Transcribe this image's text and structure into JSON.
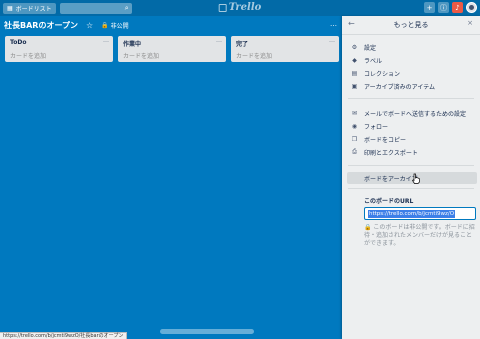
{
  "header": {
    "boards_label": "ボードリスト",
    "logo_text": "Trello",
    "search_icon": "search-icon",
    "right_icons": [
      "plus-icon",
      "info-icon",
      "bell-icon",
      "avatar"
    ]
  },
  "board": {
    "title": "社長BARのオープン",
    "visibility": "非公開",
    "more": "…"
  },
  "lists": [
    {
      "title": "ToDo",
      "add_card": "カードを追加",
      "menu": "…"
    },
    {
      "title": "作業中",
      "add_card": "カードを追加",
      "menu": "…"
    },
    {
      "title": "完了",
      "add_card": "カードを追加",
      "menu": "…"
    }
  ],
  "menu": {
    "title": "もっと見る",
    "back": "←",
    "close": "×",
    "group1": [
      {
        "icon": "gear-icon",
        "glyph": "⚙",
        "label": "設定"
      },
      {
        "icon": "label-icon",
        "glyph": "◆",
        "label": "ラベル"
      },
      {
        "icon": "collection-icon",
        "glyph": "▤",
        "label": "コレクション"
      },
      {
        "icon": "archive-icon",
        "glyph": "▣",
        "label": "アーカイブ済みのアイテム"
      }
    ],
    "group2": [
      {
        "icon": "mail-icon",
        "glyph": "✉",
        "label": "メールでボードへ送信するための設定"
      },
      {
        "icon": "eye-icon",
        "glyph": "◉",
        "label": "フォロー"
      },
      {
        "icon": "copy-icon",
        "glyph": "❐",
        "label": "ボードをコピー"
      },
      {
        "icon": "print-icon",
        "glyph": "⎙",
        "label": "印刷とエクスポート"
      }
    ],
    "archive_button": "ボードをアーカイブ",
    "url_label": "このボードのURL",
    "url_value": "https://trello.com/b/jcmti9wz/O",
    "url_note": "このボードは非公開です。ボードに招待・追加されたメンバーだけが見ることができます。"
  },
  "status_url": "https://trello.com/b/jcmti9wzO/社長barのオープン"
}
